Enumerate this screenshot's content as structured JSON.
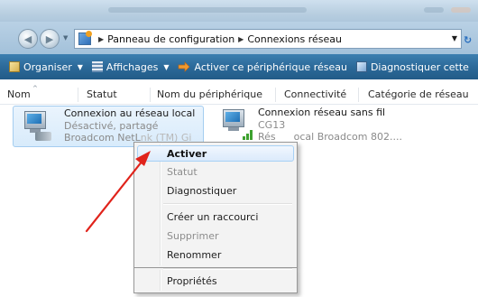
{
  "address": {
    "crumbs": [
      "Panneau de configuration",
      "Connexions réseau"
    ]
  },
  "toolbar": {
    "organize": "Organiser",
    "views": "Affichages",
    "activate": "Activer ce périphérique réseau",
    "diagnose": "Diagnostiquer cette"
  },
  "columns": [
    "Nom",
    "Statut",
    "Nom du périphérique",
    "Connectivité",
    "Catégorie de réseau"
  ],
  "connections": [
    {
      "name": "Connexion au réseau local",
      "status": "Désactivé, partagé",
      "device": "Broadcom NetL",
      "device_trailing": "nk (TM) Gi",
      "icon": "wired-network-icon"
    },
    {
      "name": "Connexion réseau sans fil",
      "status": "CG13",
      "device_leading": "Rés",
      "device": "ocal Broadcom 802....",
      "icon": "wireless-network-icon"
    }
  ],
  "context_menu": [
    {
      "label": "Activer",
      "state": "highlighted"
    },
    {
      "label": "Statut",
      "state": "disabled"
    },
    {
      "label": "Diagnostiquer",
      "state": "enabled"
    },
    {
      "separator": true
    },
    {
      "label": "Créer un raccourci",
      "state": "enabled"
    },
    {
      "label": "Supprimer",
      "state": "disabled"
    },
    {
      "label": "Renommer",
      "state": "enabled"
    },
    {
      "separator": true
    },
    {
      "label": "Propriétés",
      "state": "enabled"
    }
  ],
  "colors": {
    "command_bar": "#2c6a9a",
    "selection": "#d8ebfb",
    "annotation_arrow": "#e0231b"
  }
}
